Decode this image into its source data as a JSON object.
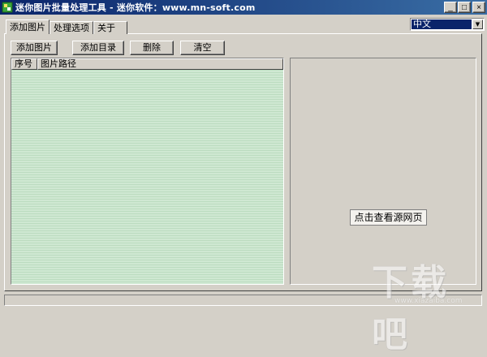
{
  "window": {
    "title": "迷你图片批量处理工具 - 迷你软件：www.mn-soft.com",
    "minimize_label": "_",
    "maximize_label": "□",
    "close_label": "×"
  },
  "tabs": [
    {
      "label": "添加图片",
      "active": true
    },
    {
      "label": "处理选项",
      "active": false
    },
    {
      "label": "关于",
      "active": false
    }
  ],
  "language": {
    "selected": "中文",
    "arrow": "▼"
  },
  "toolbar": {
    "add_image_label": "添加图片",
    "add_folder_label": "添加目录",
    "delete_label": "删除",
    "clear_label": "清空"
  },
  "file_list": {
    "columns": [
      "序号",
      "图片路径"
    ],
    "rows": []
  },
  "preview": {
    "view_source_label": "点击查看源网页"
  },
  "watermark": {
    "text": "下载吧",
    "url": "www.xiazaiba.com"
  },
  "colors": {
    "titlebar_start": "#0a246a",
    "titlebar_end": "#3a6ea5",
    "window_bg": "#d4d0c8",
    "list_bg": "#cfe8d2"
  }
}
